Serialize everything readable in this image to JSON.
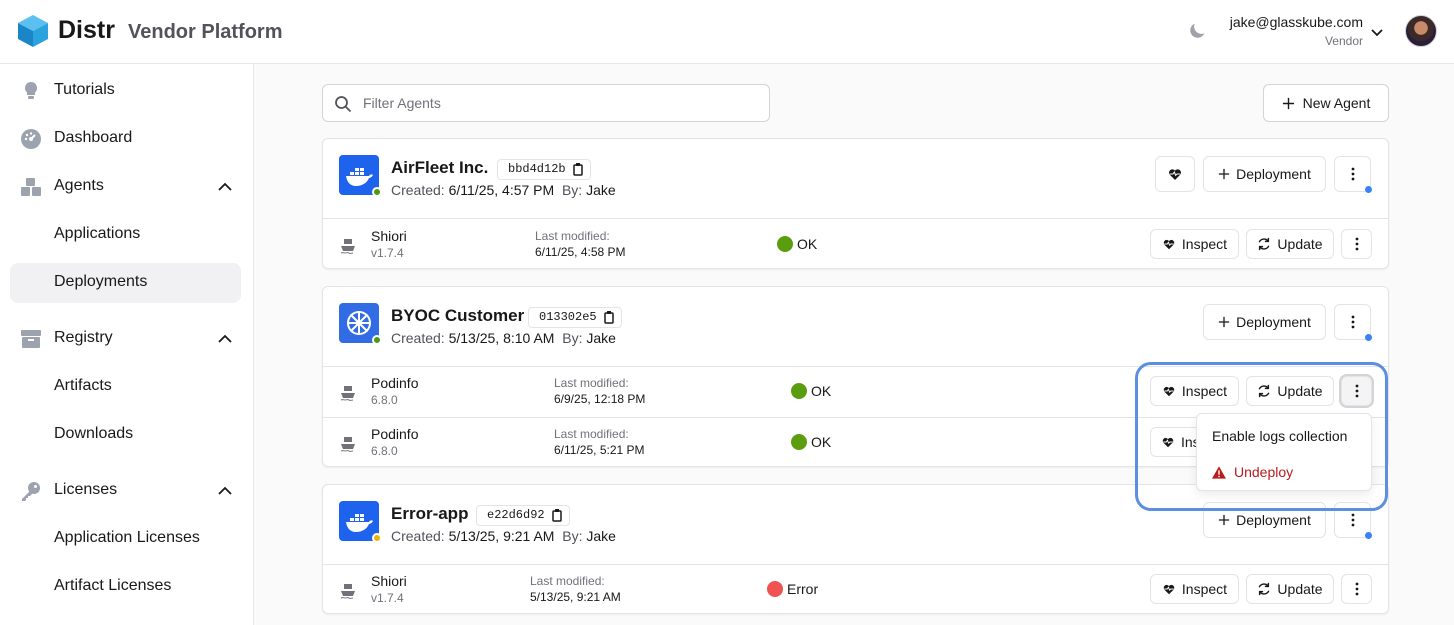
{
  "header": {
    "brand": "Distr",
    "subtitle": "Vendor Platform",
    "user_email": "jake@glasskube.com",
    "user_role": "Vendor"
  },
  "sidebar": {
    "items": [
      {
        "label": "Tutorials"
      },
      {
        "label": "Dashboard"
      },
      {
        "label": "Agents"
      },
      {
        "label": "Applications"
      },
      {
        "label": "Deployments"
      },
      {
        "label": "Registry"
      },
      {
        "label": "Artifacts"
      },
      {
        "label": "Downloads"
      },
      {
        "label": "Licenses"
      },
      {
        "label": "Application Licenses"
      },
      {
        "label": "Artifact Licenses"
      }
    ]
  },
  "toolbar": {
    "filter_placeholder": "Filter Agents",
    "new_agent_label": "New Agent"
  },
  "labels": {
    "created": "Created:",
    "by": "By:",
    "last_modified": "Last modified:",
    "deployment": "Deployment",
    "inspect": "Inspect",
    "update": "Update"
  },
  "agents": [
    {
      "name": "AirFleet Inc.",
      "id": "bbd4d12b",
      "created": "6/11/25, 4:57 PM",
      "by": "Jake",
      "status_color": "#4d9a12",
      "deployments": [
        {
          "name": "Shiori",
          "version": "v1.7.4",
          "modified": "6/11/25, 4:58 PM",
          "status": "OK",
          "status_color": "#5a9e10"
        }
      ]
    },
    {
      "name": "BYOC Customer",
      "id": "013302e5",
      "created": "5/13/25, 8:10 AM",
      "by": "Jake",
      "status_color": "#4d9a12",
      "deployments": [
        {
          "name": "Podinfo",
          "version": "6.8.0",
          "modified": "6/9/25, 12:18 PM",
          "status": "OK",
          "status_color": "#5a9e10"
        },
        {
          "name": "Podinfo",
          "version": "6.8.0",
          "modified": "6/11/25, 5:21 PM",
          "status": "OK",
          "status_color": "#5a9e10"
        }
      ]
    },
    {
      "name": "Error-app",
      "id": "e22d6d92",
      "created": "5/13/25, 9:21 AM",
      "by": "Jake",
      "status_color": "#eab308",
      "deployments": [
        {
          "name": "Shiori",
          "version": "v1.7.4",
          "modified": "5/13/25, 9:21 AM",
          "status": "Error",
          "status_color": "#f05252"
        }
      ]
    }
  ],
  "menu": {
    "item1": "Enable logs collection",
    "item2": "Undeploy"
  },
  "partial_inspect_label": "Ins"
}
